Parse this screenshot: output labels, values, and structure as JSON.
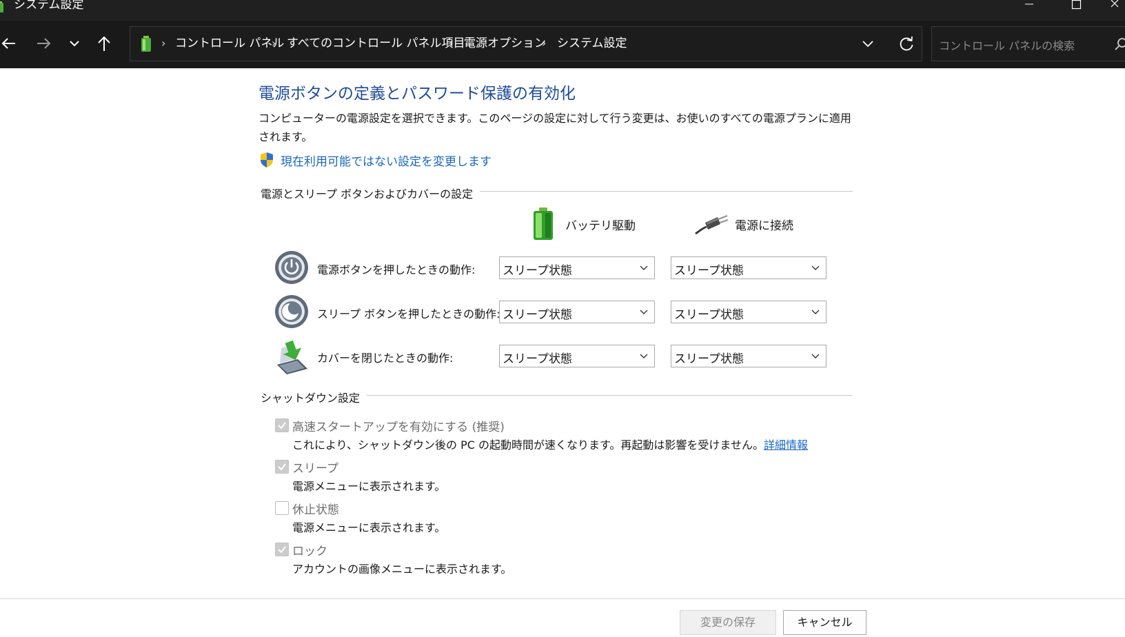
{
  "window": {
    "title": "システム設定",
    "icons": {
      "app": "battery-icon",
      "minimize": "minimize-icon",
      "maximize": "maximize-icon",
      "close": "close-icon"
    }
  },
  "nav": {
    "icons": [
      "back-arrow-icon",
      "forward-arrow-icon",
      "chevron-down-icon",
      "up-arrow-icon",
      "refresh-icon",
      "search-icon"
    ],
    "breadcrumbs": [
      "コントロール パネル",
      "すべてのコントロール パネル項目",
      "電源オプション",
      "システム設定"
    ],
    "separator": "›",
    "search_placeholder": "コントロール パネルの検索"
  },
  "page": {
    "heading": "電源ボタンの定義とパスワード保護の有効化",
    "description": "コンピューターの電源設定を選択できます。このページの設定に対して行う変更は、お使いのすべての電源プランに適用されます。",
    "admin_link": "現在利用可能ではない設定を変更します"
  },
  "power_buttons": {
    "group_title": "電源とスリープ ボタンおよびカバーの設定",
    "columns": [
      {
        "label": "バッテリ駆動",
        "icon": "battery-icon"
      },
      {
        "label": "電源に接続",
        "icon": "power-plug-icon"
      }
    ],
    "rows": [
      {
        "label": "電源ボタンを押したときの動作:",
        "icon": "power-button-icon",
        "battery": "スリープ状態",
        "plugged": "スリープ状態"
      },
      {
        "label": "スリープ ボタンを押したときの動作:",
        "icon": "sleep-button-icon",
        "battery": "スリープ状態",
        "plugged": "スリープ状態"
      },
      {
        "label": "カバーを閉じたときの動作:",
        "icon": "laptop-lid-icon",
        "battery": "スリープ状態",
        "plugged": "スリープ状態"
      }
    ]
  },
  "shutdown": {
    "group_title": "シャットダウン設定",
    "options": [
      {
        "label": "高速スタートアップを有効にする (推奨)",
        "checked": true,
        "disabled": true,
        "description": "これにより、シャットダウン後の PC の起動時間が速くなります。再起動は影響を受けません。",
        "link": "詳細情報"
      },
      {
        "label": "スリープ",
        "checked": true,
        "disabled": true,
        "description": "電源メニューに表示されます。"
      },
      {
        "label": "休止状態",
        "checked": false,
        "disabled": true,
        "description": "電源メニューに表示されます。"
      },
      {
        "label": "ロック",
        "checked": true,
        "disabled": true,
        "description": "アカウントの画像メニューに表示されます。"
      }
    ]
  },
  "footer": {
    "save_label": "変更の保存",
    "cancel_label": "キャンセル"
  },
  "colors": {
    "titlebar": "#202020",
    "navbar": "#191919",
    "heading": "#1e4c9a",
    "link": "#1a66c2",
    "disabled_text": "#6d6d6d"
  }
}
